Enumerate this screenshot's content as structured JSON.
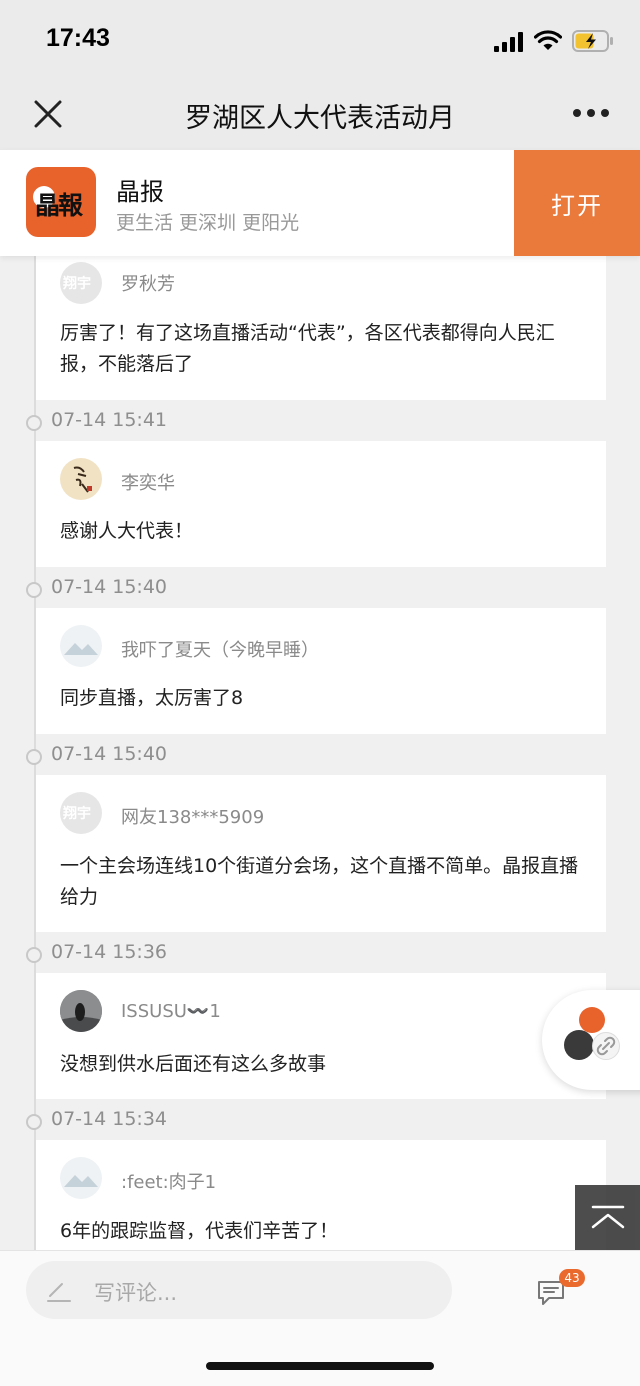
{
  "status": {
    "time": "17:43"
  },
  "nav": {
    "title": "罗湖区人大代表活动月"
  },
  "banner": {
    "logo_text": "晶報",
    "app_name": "晶报",
    "slogan": "更生活 更深圳 更阳光",
    "open_label": "打开",
    "brand_color": "#ea7a3c"
  },
  "comments": [
    {
      "user": "罗秋芳",
      "avatar": "xiangyu-avatar",
      "avatar_text": "翔宇",
      "text": "厉害了！有了这场直播活动“代表”，各区代表都得向人民汇报，不能落后了"
    },
    {
      "time": "07-14 15:41",
      "user": "李奕华",
      "avatar": "calligraphy-avatar",
      "text": "感谢人大代表！"
    },
    {
      "time": "07-14 15:40",
      "user": "我吓了夏天（今晚早睡）",
      "avatar": "mountain-avatar",
      "text": "同步直播，太厉害了8"
    },
    {
      "time": "07-14 15:40",
      "user": "网友138***5909",
      "avatar": "xiangyu-avatar",
      "avatar_text": "翔宇",
      "text": "一个主会场连线10个街道分会场，这个直播不简单。晶报直播给力"
    },
    {
      "time": "07-14 15:36",
      "user": "ISSUSU〰️1",
      "avatar": "photo-avatar",
      "text": "没想到供水后面还有这么多故事"
    },
    {
      "time": "07-14 15:34",
      "user": ":feet:肉子1",
      "avatar": "mountain-avatar",
      "text": "6年的跟踪监督，代表们辛苦了！"
    }
  ],
  "bottom": {
    "placeholder": "写评论...",
    "comment_count": "43"
  },
  "colors": {
    "accent": "#ea6a2e",
    "background": "#f0f0f0"
  }
}
